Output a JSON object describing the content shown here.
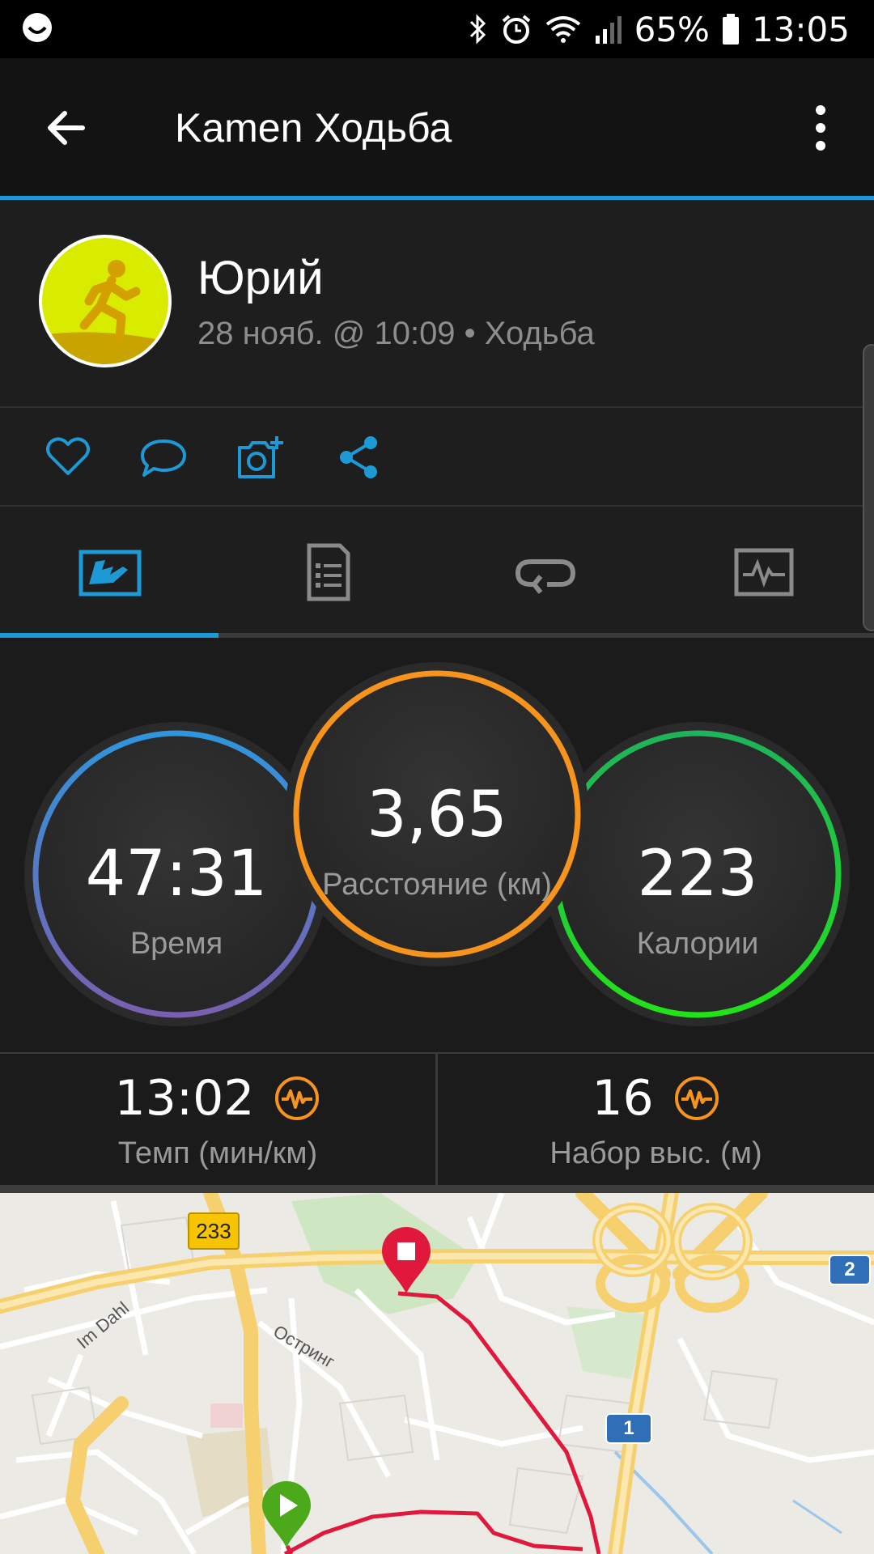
{
  "status_bar": {
    "battery_percent": "65%",
    "time": "13:05"
  },
  "app_bar": {
    "title": "Kamen Ходьба"
  },
  "profile": {
    "name": "Юрий",
    "meta": "28 нояб. @ 10:09 • Ходьба"
  },
  "tabs": {
    "active_index": 0,
    "items": [
      "overview-icon",
      "details-icon",
      "laps-icon",
      "charts-icon"
    ]
  },
  "metrics": {
    "time": {
      "value": "47:31",
      "label": "Время"
    },
    "distance": {
      "value": "3,65",
      "label": "Расстояние (км)"
    },
    "calories": {
      "value": "223",
      "label": "Калории"
    }
  },
  "sub_metrics": {
    "pace": {
      "value": "13:02",
      "label": "Темп (мин/км)"
    },
    "elevation": {
      "value": "16",
      "label": "Набор выс. (м)"
    }
  },
  "map": {
    "road_233": "233",
    "road_2": "2",
    "road_1": "1",
    "street_dahl": "Im Dahl",
    "street_ostring": "Остринг"
  },
  "colors": {
    "accent_blue": "#1d9ad6",
    "distance_orange": "#f7941d",
    "calories_green": "#22d62a",
    "route_red": "#e0183c"
  }
}
